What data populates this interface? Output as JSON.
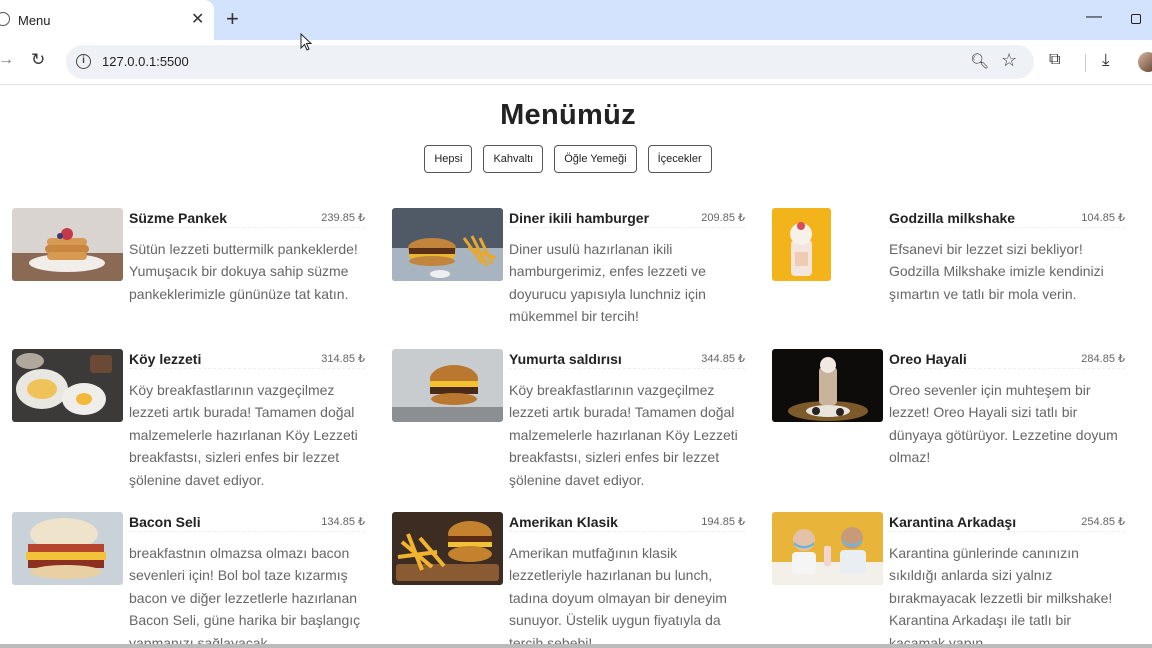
{
  "browser": {
    "tab_title": "Menu",
    "url": "127.0.0.1:5500"
  },
  "page": {
    "title": "Menümüz",
    "filters": [
      "Hepsi",
      "Kahvaltı",
      "Öğle Yemeği",
      "İçecekler"
    ]
  },
  "items": [
    {
      "name": "Süzme Pankek",
      "price": "239.85 ₺",
      "desc": "Sütün lezzeti buttermilk pankeklerde! Yumuşacık bir dokuya sahip süzme pankeklerimizle gününüze tat katın."
    },
    {
      "name": "Diner ikili hamburger",
      "price": "209.85 ₺",
      "desc": "Diner usulü hazırlanan ikili hamburgerimiz, enfes lezzeti ve doyurucu yapısıyla lunchniz için mükemmel bir tercih!"
    },
    {
      "name": "Godzilla milkshake",
      "price": "104.85 ₺",
      "desc": "Efsanevi bir lezzet sizi bekliyor! Godzilla Milkshake imizle kendinizi şımartın ve tatlı bir mola verin."
    },
    {
      "name": "Köy lezzeti",
      "price": "314.85 ₺",
      "desc": "Köy breakfastlarının vazgeçilmez lezzeti artık burada! Tamamen doğal malzemelerle hazırlanan Köy Lezzeti breakfastsı, sizleri enfes bir lezzet şölenine davet ediyor."
    },
    {
      "name": "Yumurta saldırısı",
      "price": "344.85 ₺",
      "desc": "Köy breakfastlarının vazgeçilmez lezzeti artık burada! Tamamen doğal malzemelerle hazırlanan Köy Lezzeti breakfastsı, sizleri enfes bir lezzet şölenine davet ediyor."
    },
    {
      "name": "Oreo Hayali",
      "price": "284.85 ₺",
      "desc": "Oreo sevenler için muhteşem bir lezzet! Oreo Hayali sizi tatlı bir dünyaya götürüyor. Lezzetine doyum olmaz!"
    },
    {
      "name": "Bacon Seli",
      "price": "134.85 ₺",
      "desc": "breakfastnın olmazsa olmazı bacon sevenleri için! Bol bol taze kızarmış bacon ve diğer lezzetlerle hazırlanan Bacon Seli, güne harika bir başlangıç yapmanızı sağlayacak."
    },
    {
      "name": "Amerikan Klasik",
      "price": "194.85 ₺",
      "desc": "Amerikan mutfağının klasik lezzetleriyle hazırlanan bu lunch, tadına doyum olmayan bir deneyim sunuyor. Üstelik uygun fiyatıyla da tercih sebebi!"
    },
    {
      "name": "Karantina Arkadaşı",
      "price": "254.85 ₺",
      "desc": "Karantina günlerinde canınızın sıkıldığı anlarda sizi yalnız bırakmayacak lezzetli bir milkshake! Karantina Arkadaşı ile tatlı bir kaçamak yapın."
    }
  ]
}
